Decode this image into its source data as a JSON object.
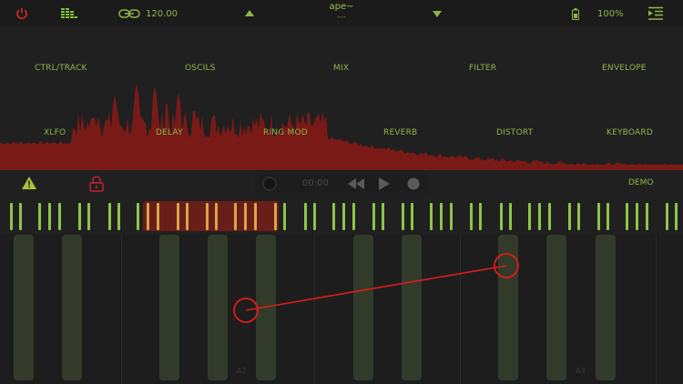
{
  "topbar": {
    "tempo": "120.00",
    "preset_name": "ape~",
    "preset_sub": "---",
    "battery": "100%"
  },
  "menu": {
    "row1": [
      "CTRL/TRACK",
      "OSCILS",
      "MIX",
      "FILTER",
      "ENVELOPE"
    ],
    "row2": [
      "XLFO",
      "DELAY",
      "RING MOD",
      "REVERB",
      "DISTORT",
      "KEYBOARD"
    ]
  },
  "transport": {
    "time": "00:00",
    "demo": "DEMO"
  },
  "keyboard": {
    "labels": [
      "A2",
      "A3"
    ]
  },
  "colors": {
    "accent": "#8fbf3a",
    "waveform": "#7a1a17",
    "range": "#6a1e1a",
    "gesture": "#e01b1b",
    "warning": "#a8c43c",
    "lock": "#c0262a",
    "power": "#d42a2a"
  },
  "icons": {
    "power": "power-icon",
    "meter": "level-meter-icon",
    "link": "link-icon",
    "up": "triangle-up-icon",
    "down": "triangle-down-icon",
    "battery": "battery-icon",
    "menu": "menu-indent-icon",
    "warning": "warning-icon",
    "lock": "lock-icon",
    "loop": "loop-icon",
    "rewind": "rewind-icon",
    "play": "play-icon",
    "record": "record-icon"
  }
}
